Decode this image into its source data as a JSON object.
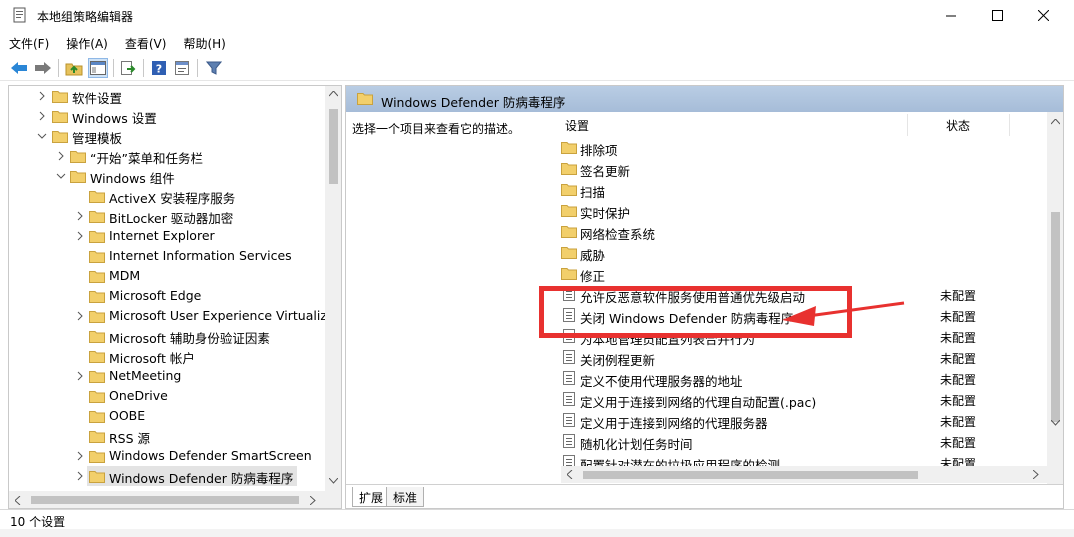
{
  "window": {
    "title": "本地组策略编辑器",
    "minimize": "—",
    "maximize": "☐",
    "close": "✕"
  },
  "menu": [
    "文件(F)",
    "操作(A)",
    "查看(V)",
    "帮助(H)"
  ],
  "toolbar": {
    "icons": [
      "back-icon",
      "forward-icon",
      "up-folder-icon",
      "show-tree-icon",
      "export-list-icon",
      "help-icon",
      "properties-icon",
      "filter-icon"
    ]
  },
  "tree": {
    "items": [
      {
        "label": "软件设置",
        "level": 1,
        "expanded": false,
        "has_children": true
      },
      {
        "label": "Windows 设置",
        "level": 1,
        "expanded": false,
        "has_children": true
      },
      {
        "label": "管理模板",
        "level": 1,
        "expanded": true,
        "has_children": true
      },
      {
        "label": "“开始”菜单和任务栏",
        "level": 2,
        "expanded": false,
        "has_children": true
      },
      {
        "label": "Windows 组件",
        "level": 2,
        "expanded": true,
        "has_children": true
      },
      {
        "label": "ActiveX 安装程序服务",
        "level": 3,
        "expanded": false,
        "has_children": false
      },
      {
        "label": "BitLocker 驱动器加密",
        "level": 3,
        "expanded": false,
        "has_children": true
      },
      {
        "label": "Internet Explorer",
        "level": 3,
        "expanded": false,
        "has_children": true
      },
      {
        "label": "Internet Information Services",
        "level": 3,
        "expanded": false,
        "has_children": false
      },
      {
        "label": "MDM",
        "level": 3,
        "expanded": false,
        "has_children": false
      },
      {
        "label": "Microsoft Edge",
        "level": 3,
        "expanded": false,
        "has_children": false
      },
      {
        "label": "Microsoft User Experience Virtualiza",
        "level": 3,
        "expanded": false,
        "has_children": true
      },
      {
        "label": "Microsoft 辅助身份验证因素",
        "level": 3,
        "expanded": false,
        "has_children": false
      },
      {
        "label": "Microsoft 帐户",
        "level": 3,
        "expanded": false,
        "has_children": false
      },
      {
        "label": "NetMeeting",
        "level": 3,
        "expanded": false,
        "has_children": true
      },
      {
        "label": "OneDrive",
        "level": 3,
        "expanded": false,
        "has_children": false
      },
      {
        "label": "OOBE",
        "level": 3,
        "expanded": false,
        "has_children": false
      },
      {
        "label": "RSS 源",
        "level": 3,
        "expanded": false,
        "has_children": false
      },
      {
        "label": "Windows Defender SmartScreen",
        "level": 3,
        "expanded": false,
        "has_children": true
      },
      {
        "label": "Windows Defender 防病毒程序",
        "level": 3,
        "expanded": false,
        "has_children": true,
        "selected": true
      }
    ]
  },
  "right": {
    "title": "Windows Defender 防病毒程序",
    "description": "选择一个项目来查看它的描述。",
    "columns": {
      "setting": "设置",
      "state": "状态"
    },
    "folders": [
      "排除项",
      "签名更新",
      "扫描",
      "实时保护",
      "网络检查系统",
      "威胁",
      "修正"
    ],
    "settings": [
      {
        "label": "允许反恶意软件服务使用普通优先级启动",
        "state": "未配置"
      },
      {
        "label": "关闭 Windows Defender 防病毒程序",
        "state": "未配置"
      },
      {
        "label": "为本地管理员配置列表合并行为",
        "state": "未配置"
      },
      {
        "label": "关闭例程更新",
        "state": "未配置"
      },
      {
        "label": "定义不使用代理服务器的地址",
        "state": "未配置"
      },
      {
        "label": "定义用于连接到网络的代理自动配置(.pac)",
        "state": "未配置"
      },
      {
        "label": "定义用于连接到网络的代理服务器",
        "state": "未配置"
      },
      {
        "label": "随机化计划任务时间",
        "state": "未配置"
      },
      {
        "label": "配置针对潜在的垃圾应用程序的检测",
        "state": "未配置"
      }
    ],
    "tabs": [
      "扩展",
      "标准"
    ]
  },
  "status": "10 个设置",
  "annotation_color": "#e8312f"
}
